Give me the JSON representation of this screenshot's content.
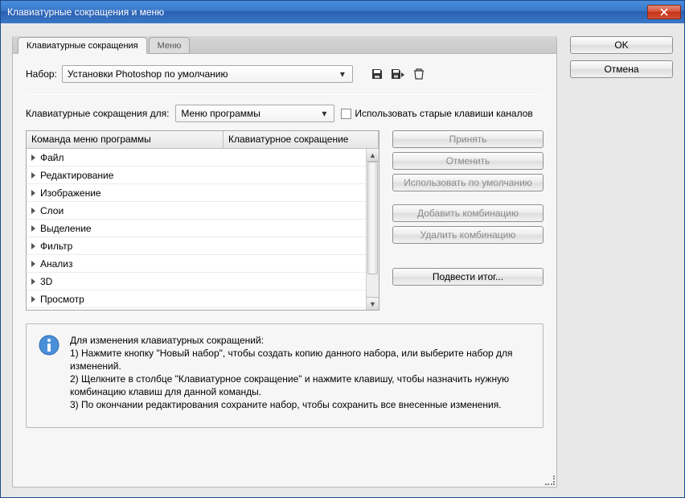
{
  "window": {
    "title": "Клавиатурные сокращения и меню"
  },
  "side": {
    "ok": "OK",
    "cancel": "Отмена"
  },
  "tabs": {
    "shortcuts": "Клавиатурные сокращения",
    "menus": "Меню"
  },
  "set_row": {
    "label": "Набор:",
    "value": "Установки Photoshop по умолчанию"
  },
  "for_row": {
    "label": "Клавиатурные сокращения для:",
    "value": "Меню программы",
    "legacy_checkbox": "Использовать старые клавиши каналов"
  },
  "table": {
    "header_cmd": "Команда меню программы",
    "header_short": "Клавиатурное сокращение",
    "rows": [
      "Файл",
      "Редактирование",
      "Изображение",
      "Слои",
      "Выделение",
      "Фильтр",
      "Анализ",
      "3D",
      "Просмотр"
    ]
  },
  "actions": {
    "accept": "Принять",
    "undo": "Отменить",
    "use_default": "Использовать по умолчанию",
    "add": "Добавить комбинацию",
    "delete": "Удалить комбинацию",
    "summarize": "Подвести итог..."
  },
  "info": {
    "header": "Для изменения клавиатурных сокращений:",
    "line1": "1) Нажмите кнопку \"Новый набор\", чтобы создать копию данного набора, или выберите набор для изменений.",
    "line2": "2) Щелкните в столбце \"Клавиатурное сокращение\" и нажмите клавишу, чтобы назначить нужную комбинацию клавиш для данной команды.",
    "line3": "3) По окончании редактирования сохраните набор, чтобы сохранить все внесенные изменения."
  }
}
